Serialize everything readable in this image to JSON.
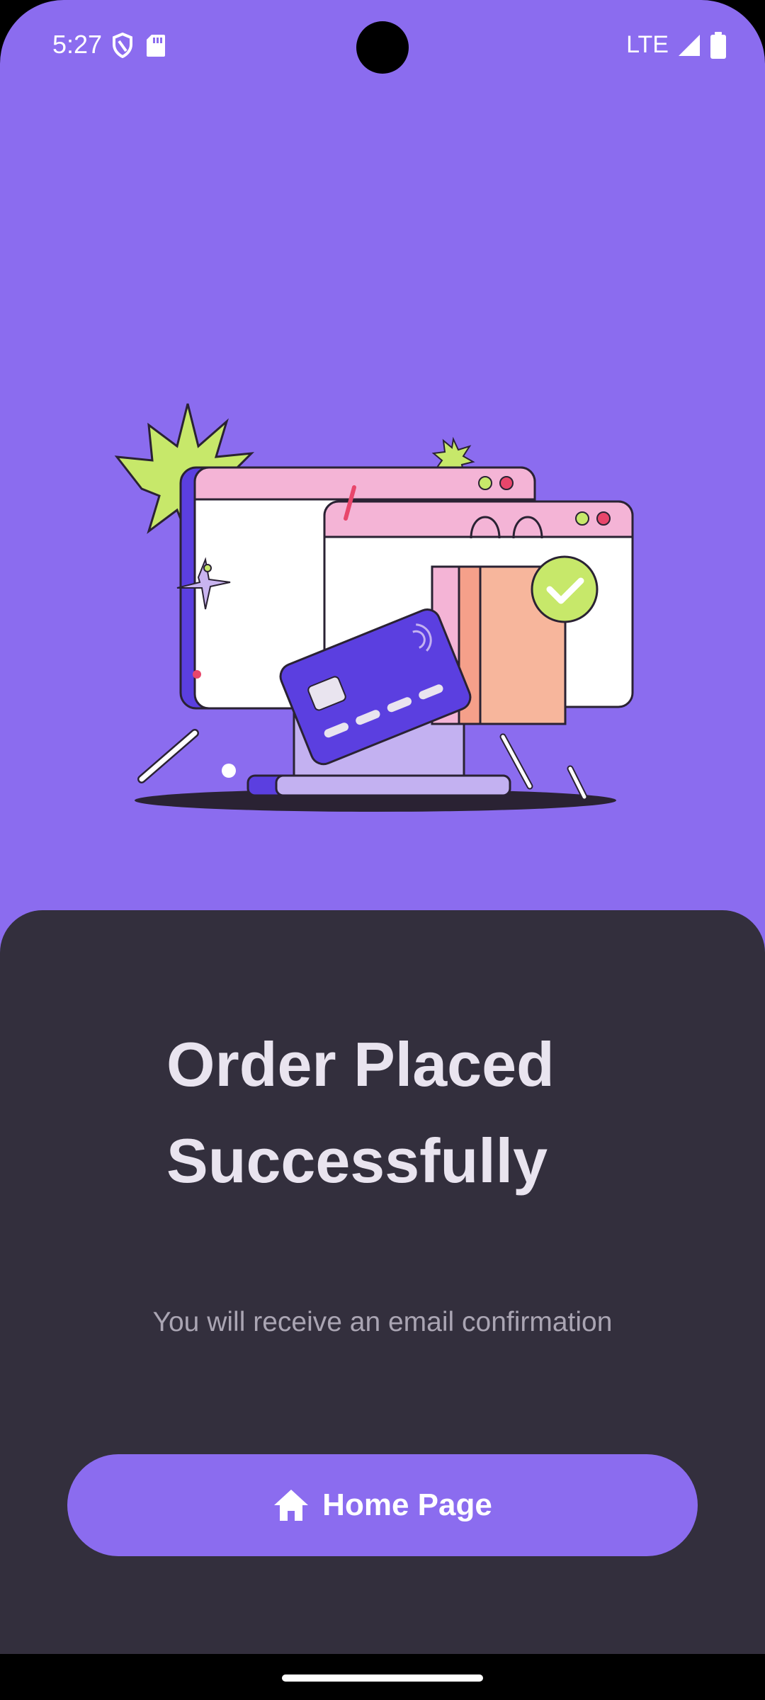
{
  "status_bar": {
    "time": "5:27",
    "network": "LTE",
    "icons": [
      "shield-icon",
      "sd-card-icon",
      "signal-icon",
      "battery-icon"
    ]
  },
  "main": {
    "illustration": "order-success-illustration",
    "title_line1": "Order Placed",
    "title_line2": "Successfully",
    "subtitle": "You will receive an email confirmation",
    "home_button_label": "Home Page",
    "home_button_icon": "home-icon"
  },
  "colors": {
    "accent": "#8b6cef",
    "sheet_background": "#332f3d",
    "title_text": "#e9e4ef",
    "subtitle_text": "#aaa5b3"
  }
}
